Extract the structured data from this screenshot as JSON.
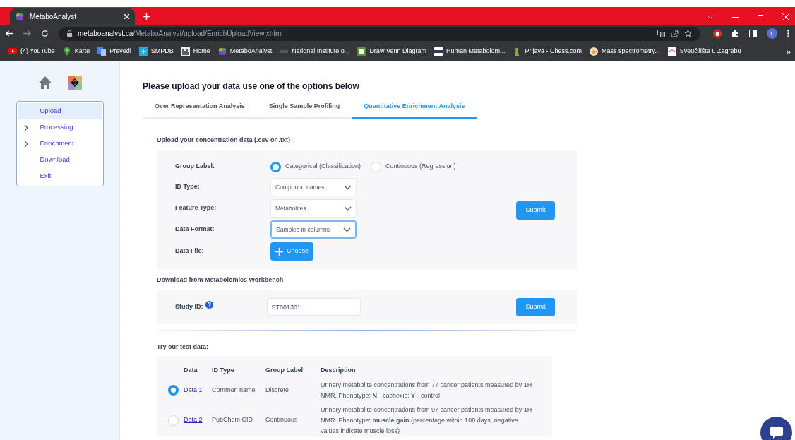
{
  "browser": {
    "tab_title": "MetaboAnalyst",
    "url_domain": "metaboanalyst.ca",
    "url_path": "/MetaboAnalyst/upload/EnrichUploadView.xhtml",
    "bookmarks": [
      {
        "label": "(4) YouTube",
        "kind": "youtube"
      },
      {
        "label": "Karte",
        "kind": "maps"
      },
      {
        "label": "Prevedi",
        "kind": "translate"
      },
      {
        "label": "SMPDB",
        "kind": "smpdb"
      },
      {
        "label": "Home",
        "kind": "home"
      },
      {
        "label": "MetaboAnalyst",
        "kind": "metabo"
      },
      {
        "label": "National Institute o...",
        "kind": "nih"
      },
      {
        "label": "Draw Venn Diagram",
        "kind": "venn"
      },
      {
        "label": "Human Metabolom...",
        "kind": "hmdb"
      },
      {
        "label": "Prijava - Chess.com",
        "kind": "chess"
      },
      {
        "label": "Mass spectrometry...",
        "kind": "mass"
      },
      {
        "label": "Sveučilište u Zagrebu",
        "kind": "uni"
      }
    ],
    "more": "»",
    "avatar": "L"
  },
  "sidebar": {
    "items": [
      {
        "label": "Upload",
        "selected": true,
        "expandable": false
      },
      {
        "label": "Processing",
        "selected": false,
        "expandable": true
      },
      {
        "label": "Enrichment",
        "selected": false,
        "expandable": true
      },
      {
        "label": "Download",
        "selected": false,
        "expandable": false
      },
      {
        "label": "Exit",
        "selected": false,
        "expandable": false
      }
    ]
  },
  "heading": "Please upload your data use one of the options below",
  "tabs": [
    {
      "label": "Over Representation Analysis",
      "selected": false
    },
    {
      "label": "Single Sample Profiling",
      "selected": false
    },
    {
      "label": "Quantitative Enrichment Analysis",
      "selected": true
    }
  ],
  "upload": {
    "title": "Upload your concentration data (.csv or .txt)",
    "group_label": {
      "label": "Group Label:",
      "options": [
        {
          "label": "Categorical (Classification)",
          "selected": true
        },
        {
          "label": "Continuous (Regression)",
          "selected": false
        }
      ]
    },
    "selects": [
      {
        "label": "ID Type:",
        "value": "Compound names",
        "focused": false
      },
      {
        "label": "Feature Type:",
        "value": "Metabolites",
        "focused": false
      },
      {
        "label": "Data Format:",
        "value": "Samples in columns",
        "focused": true
      }
    ],
    "file": {
      "label": "Data File:",
      "button": "Choose"
    },
    "submit": "Submit"
  },
  "workbench": {
    "title": "Download from Metabolomics Workbench",
    "label": "Study ID:",
    "value": "ST001301",
    "submit": "Submit"
  },
  "test_data": {
    "title": "Try our test data:",
    "columns": [
      "Data",
      "ID Type",
      "Group Label",
      "Description"
    ],
    "rows": [
      {
        "selected": true,
        "data": "Data 1",
        "id_type": "Common name",
        "group_label": "Discrete",
        "description": "Urinary metabolite concentrations from 77 cancer patients measured by 1H NMR. Phenotype: **N** - cachexic; **Y** - control"
      },
      {
        "selected": false,
        "data": "Data 2",
        "id_type": "PubChem CID",
        "group_label": "Continuous",
        "description": "Urinary metabolite concentrations from 97 cancer patients measured by 1H NMR. Phenotype: **muscle gain** (percentage within 100 days, negative values indicate muscle loss)"
      }
    ]
  }
}
